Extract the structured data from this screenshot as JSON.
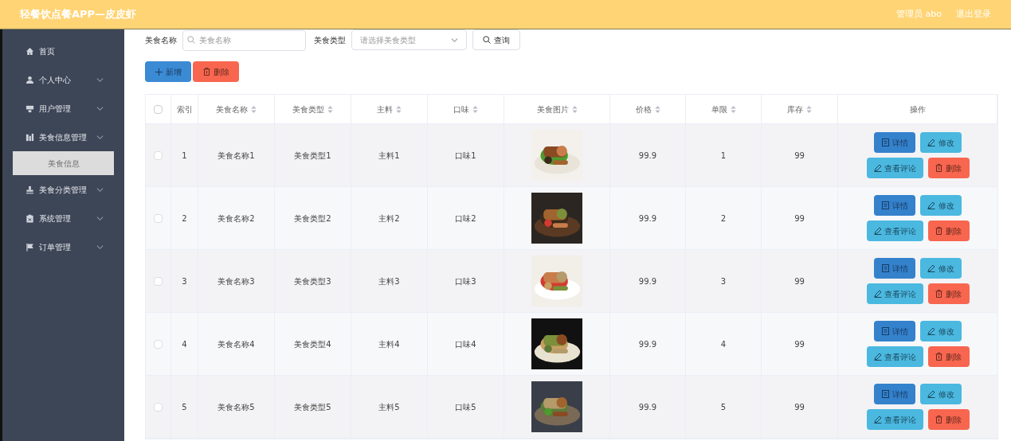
{
  "header": {
    "title": "轻餐饮点餐APP—皮皮虾",
    "user": "管理员 abo",
    "logout": "退出登录"
  },
  "sidebar": {
    "items": [
      {
        "label": "首页",
        "kind": "home",
        "expanded": false,
        "has_caret": false
      },
      {
        "label": "个人中心",
        "kind": "user",
        "expanded": false,
        "has_caret": true
      },
      {
        "label": "用户管理",
        "kind": "users",
        "expanded": false,
        "has_caret": true
      },
      {
        "label": "美食信息管理",
        "kind": "chart",
        "expanded": true,
        "has_caret": true,
        "children": [
          {
            "label": "美食信息",
            "selected": true
          }
        ]
      },
      {
        "label": "美食分类管理",
        "kind": "stamp",
        "expanded": false,
        "has_caret": true
      },
      {
        "label": "系统管理",
        "kind": "clipboard",
        "expanded": false,
        "has_caret": true
      },
      {
        "label": "订单管理",
        "kind": "flag",
        "expanded": false,
        "has_caret": true
      }
    ]
  },
  "search": {
    "fields": [
      {
        "label": "美食名称",
        "placeholder": "美食名称",
        "kind": "text"
      },
      {
        "label": "美食类型",
        "placeholder": "请选择美食类型",
        "kind": "select"
      }
    ],
    "button": "查询"
  },
  "actions": {
    "add": "新增",
    "delete": "删除"
  },
  "table": {
    "select_all_checked": false,
    "columns": [
      {
        "label": "索引",
        "sortable": false
      },
      {
        "label": "美食名称",
        "sortable": true
      },
      {
        "label": "美食类型",
        "sortable": true
      },
      {
        "label": "主料",
        "sortable": true
      },
      {
        "label": "口味",
        "sortable": true
      },
      {
        "label": "美食图片",
        "sortable": true
      },
      {
        "label": "价格",
        "sortable": true
      },
      {
        "label": "单限",
        "sortable": true
      },
      {
        "label": "库存",
        "sortable": true
      },
      {
        "label": "操作",
        "sortable": false
      }
    ],
    "rows": [
      {
        "index": "1",
        "name": "美食名称1",
        "type": "美食类型1",
        "main": "主料1",
        "taste": "口味1",
        "price": "99.9",
        "limit": "1",
        "stock": "99",
        "checked": false,
        "actions": [
          {
            "kind": "detail",
            "label": "详情"
          },
          {
            "kind": "edit",
            "label": "修改"
          },
          {
            "kind": "comments",
            "label": "查看评论"
          },
          {
            "kind": "delete",
            "label": "删除"
          }
        ]
      },
      {
        "index": "2",
        "name": "美食名称2",
        "type": "美食类型2",
        "main": "主料2",
        "taste": "口味2",
        "price": "99.9",
        "limit": "2",
        "stock": "99",
        "checked": false,
        "actions": [
          {
            "kind": "detail",
            "label": "详情"
          },
          {
            "kind": "edit",
            "label": "修改"
          },
          {
            "kind": "comments",
            "label": "查看评论"
          },
          {
            "kind": "delete",
            "label": "删除"
          }
        ]
      },
      {
        "index": "3",
        "name": "美食名称3",
        "type": "美食类型3",
        "main": "主料3",
        "taste": "口味3",
        "price": "99.9",
        "limit": "3",
        "stock": "99",
        "checked": false,
        "actions": [
          {
            "kind": "detail",
            "label": "详情"
          },
          {
            "kind": "edit",
            "label": "修改"
          },
          {
            "kind": "comments",
            "label": "查看评论"
          },
          {
            "kind": "delete",
            "label": "删除"
          }
        ]
      },
      {
        "index": "4",
        "name": "美食名称4",
        "type": "美食类型4",
        "main": "主料4",
        "taste": "口味4",
        "price": "99.9",
        "limit": "4",
        "stock": "99",
        "checked": false,
        "actions": [
          {
            "kind": "detail",
            "label": "详情"
          },
          {
            "kind": "edit",
            "label": "修改"
          },
          {
            "kind": "comments",
            "label": "查看评论"
          },
          {
            "kind": "delete",
            "label": "删除"
          }
        ]
      },
      {
        "index": "5",
        "name": "美食名称5",
        "type": "美食类型5",
        "main": "主料5",
        "taste": "口味5",
        "price": "99.9",
        "limit": "5",
        "stock": "99",
        "checked": false,
        "actions": [
          {
            "kind": "detail",
            "label": "详情"
          },
          {
            "kind": "edit",
            "label": "修改"
          },
          {
            "kind": "comments",
            "label": "查看评论"
          },
          {
            "kind": "delete",
            "label": "删除"
          }
        ]
      }
    ]
  }
}
